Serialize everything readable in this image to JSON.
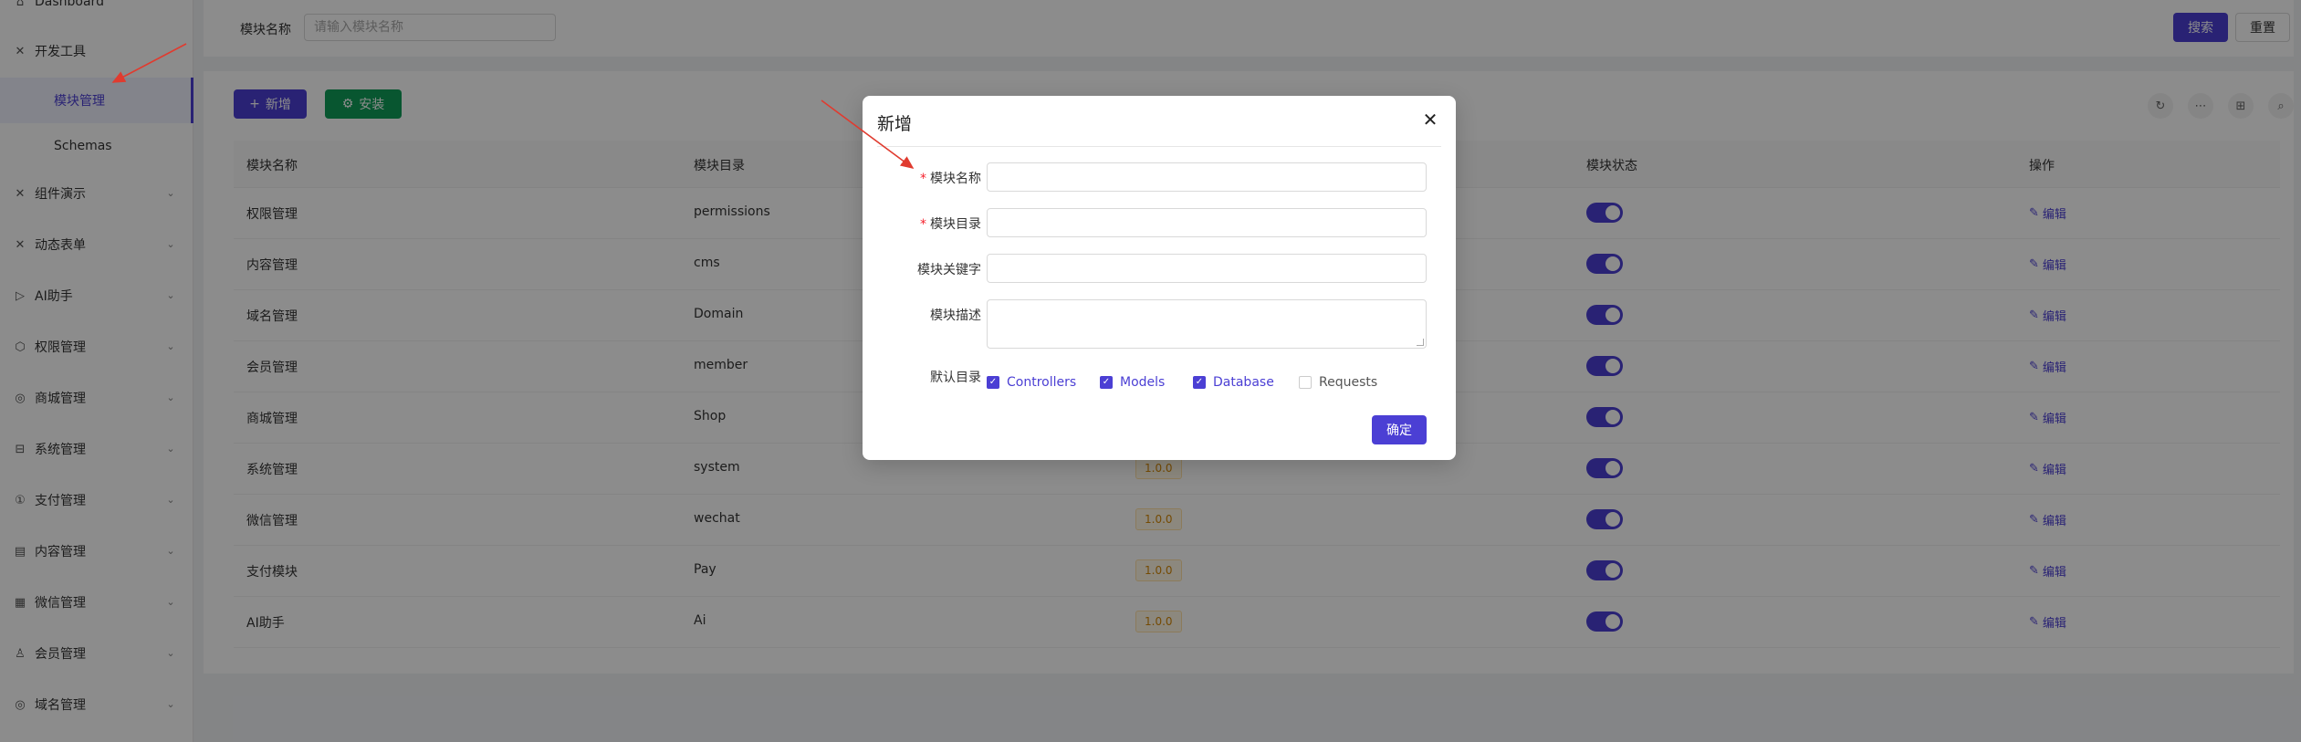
{
  "sidebar": {
    "items": [
      {
        "label": "Dashboard",
        "icon": "home-icon",
        "glyph": "⌂",
        "has_chevron": false
      },
      {
        "label": "开发工具",
        "icon": "tools-icon",
        "glyph": "✕",
        "has_chevron": false
      },
      {
        "label": "组件演示",
        "icon": "tools-icon",
        "glyph": "✕",
        "has_chevron": true
      },
      {
        "label": "动态表单",
        "icon": "tools-icon",
        "glyph": "✕",
        "has_chevron": true
      },
      {
        "label": "AI助手",
        "icon": "send-icon",
        "glyph": "▷",
        "has_chevron": true
      },
      {
        "label": "权限管理",
        "icon": "cube-icon",
        "glyph": "⬡",
        "has_chevron": true
      },
      {
        "label": "商城管理",
        "icon": "shop-icon",
        "glyph": "◎",
        "has_chevron": true
      },
      {
        "label": "系统管理",
        "icon": "system-icon",
        "glyph": "⊟",
        "has_chevron": true
      },
      {
        "label": "支付管理",
        "icon": "pay-icon",
        "glyph": "①",
        "has_chevron": true
      },
      {
        "label": "内容管理",
        "icon": "content-icon",
        "glyph": "▤",
        "has_chevron": true
      },
      {
        "label": "微信管理",
        "icon": "wechat-icon",
        "glyph": "▦",
        "has_chevron": true
      },
      {
        "label": "会员管理",
        "icon": "user-icon",
        "glyph": "♙",
        "has_chevron": true
      },
      {
        "label": "域名管理",
        "icon": "domain-icon",
        "glyph": "◎",
        "has_chevron": true
      }
    ],
    "submenu": [
      {
        "label": "模块管理",
        "active": true
      },
      {
        "label": "Schemas",
        "active": false
      }
    ]
  },
  "search": {
    "label": "模块名称",
    "placeholder": "请输入模块名称",
    "search_button": "搜索",
    "reset_button": "重置"
  },
  "toolbar": {
    "add_button": "新增",
    "install_button": "安装",
    "icons": [
      "refresh-icon",
      "more-icon",
      "columns-icon",
      "search-icon"
    ]
  },
  "table": {
    "columns": [
      "模块名称",
      "模块目录",
      "模块状态",
      "操作"
    ],
    "edit_label": "编辑",
    "rows": [
      {
        "name": "权限管理",
        "dir": "permissions",
        "version": "",
        "enabled": true
      },
      {
        "name": "内容管理",
        "dir": "cms",
        "version": "",
        "enabled": true
      },
      {
        "name": "域名管理",
        "dir": "Domain",
        "version": "",
        "enabled": true
      },
      {
        "name": "会员管理",
        "dir": "member",
        "version": "",
        "enabled": true
      },
      {
        "name": "商城管理",
        "dir": "Shop",
        "version": "",
        "enabled": true
      },
      {
        "name": "系统管理",
        "dir": "system",
        "version": "1.0.0",
        "enabled": true
      },
      {
        "name": "微信管理",
        "dir": "wechat",
        "version": "1.0.0",
        "enabled": true
      },
      {
        "name": "支付模块",
        "dir": "Pay",
        "version": "1.0.0",
        "enabled": true
      },
      {
        "name": "AI助手",
        "dir": "Ai",
        "version": "1.0.0",
        "enabled": true
      }
    ]
  },
  "modal": {
    "title": "新增",
    "fields": {
      "name_label": "模块名称",
      "dir_label": "模块目录",
      "keyword_label": "模块关键字",
      "desc_label": "模块描述",
      "default_dirs_label": "默认目录"
    },
    "checkboxes": [
      {
        "label": "Controllers",
        "checked": true
      },
      {
        "label": "Models",
        "checked": true
      },
      {
        "label": "Database",
        "checked": true
      },
      {
        "label": "Requests",
        "checked": false
      }
    ],
    "submit_button": "确定"
  },
  "colors": {
    "primary": "#4b3fd4",
    "success": "#0f9d58",
    "required": "#f5222d",
    "annotation_arrow": "#e03b2f"
  }
}
